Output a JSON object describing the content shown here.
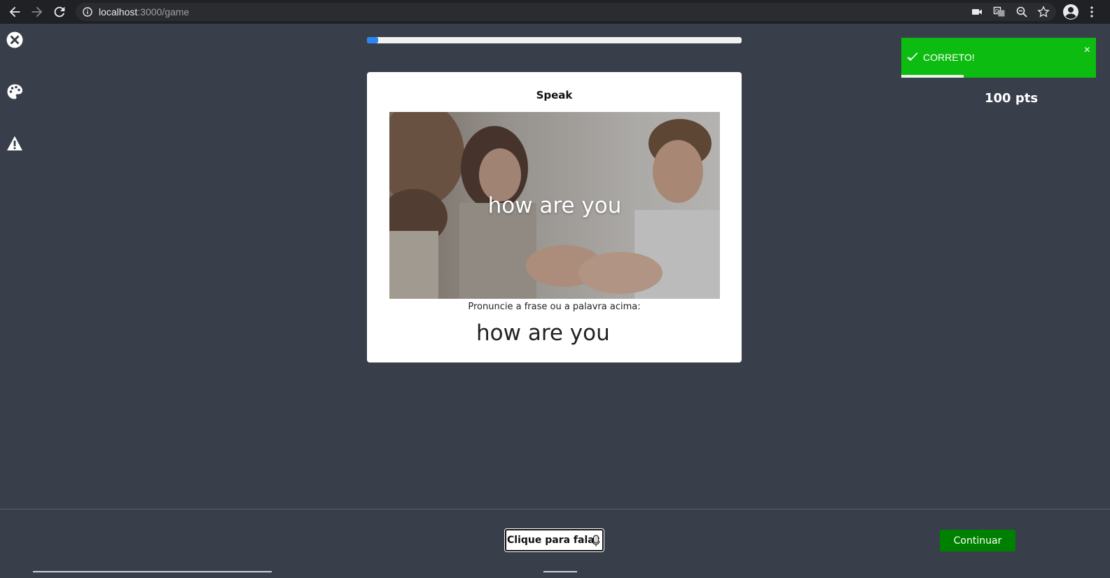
{
  "browser": {
    "url_host": "localhost",
    "url_path": ":3000/game",
    "icons": [
      "back-arrow-icon",
      "forward-arrow-icon",
      "reload-icon",
      "info-icon",
      "camera-icon",
      "translate-icon",
      "zoom-icon",
      "star-icon",
      "profile-icon",
      "more-icon"
    ]
  },
  "sidebar": {
    "icons": [
      "close-circle-icon",
      "palette-icon",
      "warning-icon"
    ]
  },
  "progress": {
    "fraction": 0.03,
    "color": "#2b87f0"
  },
  "card": {
    "title": "Speak",
    "image_caption": "how are you",
    "instruction": "Pronuncie a frase ou a palavra acima:",
    "recognized_text": "how are you"
  },
  "toast": {
    "message": "CORRETO!",
    "close_symbol": "×",
    "color": "#0cbc10",
    "timer_fraction": 0.32
  },
  "score": {
    "label": "100 pts"
  },
  "footer": {
    "speak_button": "Clique para falar",
    "continue_button": "Continuar",
    "continue_color": "#008000"
  }
}
